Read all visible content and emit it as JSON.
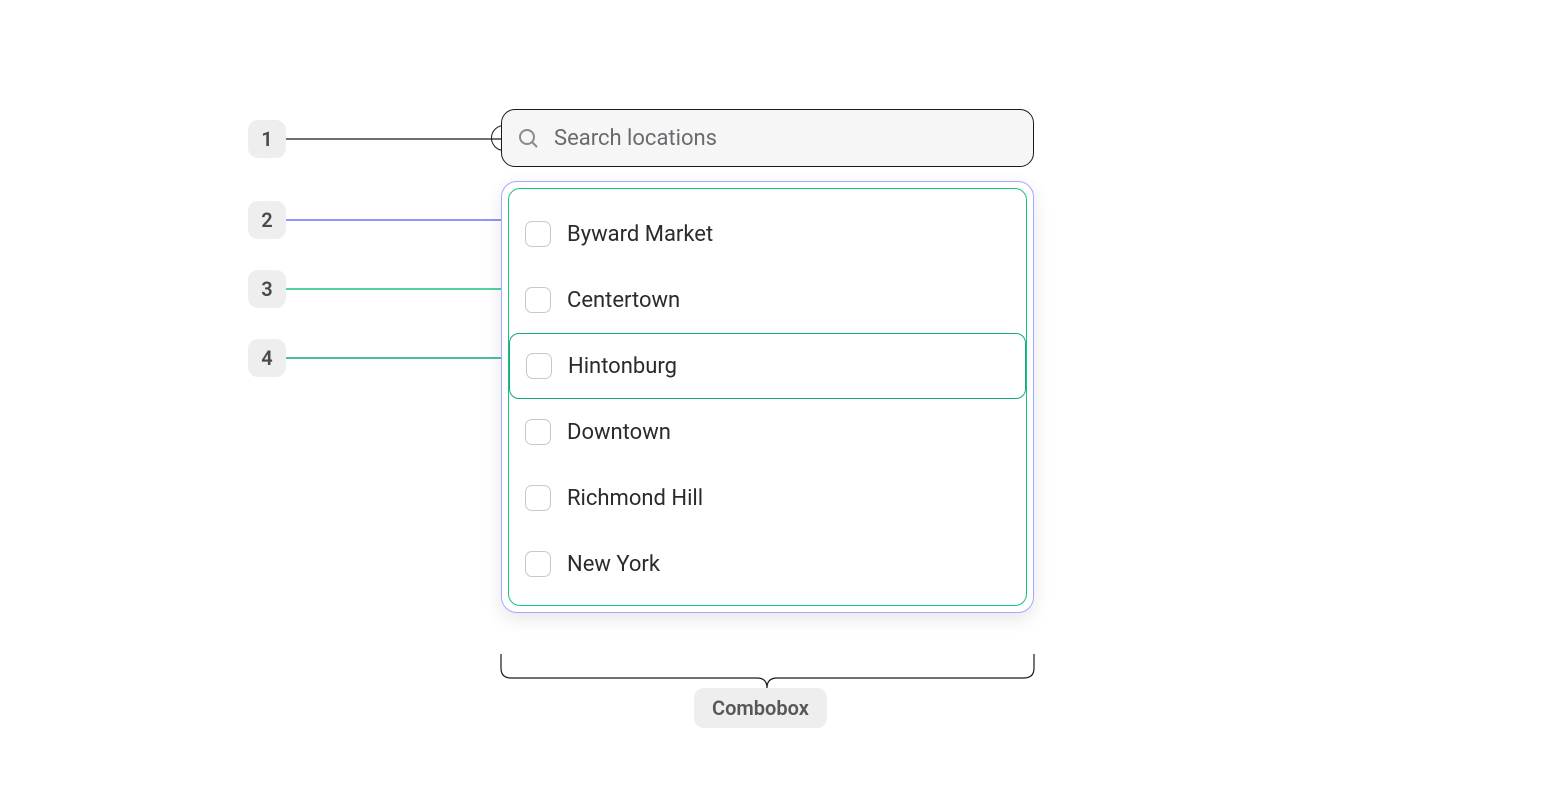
{
  "annotations": {
    "badge1": "1",
    "badge2": "2",
    "badge3": "3",
    "badge4": "4"
  },
  "textfield": {
    "placeholder": "Search locations"
  },
  "listbox": {
    "options": [
      {
        "label": "Byward Market",
        "highlighted": false
      },
      {
        "label": "Centertown",
        "highlighted": false
      },
      {
        "label": "Hintonburg",
        "highlighted": true
      },
      {
        "label": "Downtown",
        "highlighted": false
      },
      {
        "label": "Richmond Hill",
        "highlighted": false
      },
      {
        "label": "New York",
        "highlighted": false
      }
    ]
  },
  "caption": "Combobox",
  "colors": {
    "line1": "#1a1a1a",
    "line2": "#6b72ff",
    "line3": "#19c37d",
    "line4": "#12a886"
  }
}
